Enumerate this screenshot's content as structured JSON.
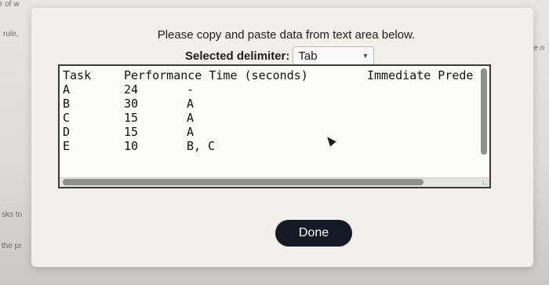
{
  "background": {
    "snippets": [
      "r of w",
      "rule,",
      "sks to",
      "the pr",
      "lence n"
    ]
  },
  "modal": {
    "instruction": "Please copy and paste data from text area below.",
    "delimiter_label": "Selected delimiter:",
    "delimiter_value": "Tab",
    "textarea": {
      "headers": [
        "Task",
        "Performance Time  (seconds)",
        "Immediate Prede"
      ],
      "rows": [
        {
          "task": "A",
          "time": "24",
          "pred": "-"
        },
        {
          "task": "B",
          "time": "30",
          "pred": "A"
        },
        {
          "task": "C",
          "time": "15",
          "pred": "A"
        },
        {
          "task": "D",
          "time": "15",
          "pred": "A"
        },
        {
          "task": "E",
          "time": "10",
          "pred": "B, C"
        }
      ]
    },
    "done_label": "Done"
  },
  "colors": {
    "button_bg": "#131925",
    "modal_bg": "#f1f0ed",
    "textarea_border": "#3a3a3a"
  },
  "icons": [
    "chevron-down-icon",
    "resize-grip-icon",
    "mouse-cursor-icon"
  ]
}
